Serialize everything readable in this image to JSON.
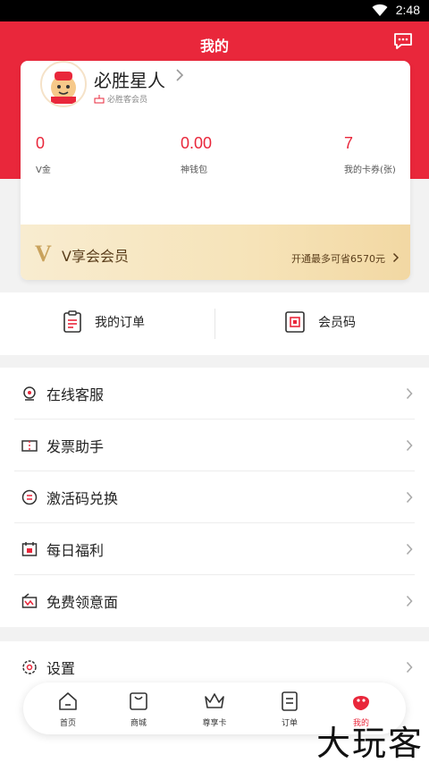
{
  "status_bar": {
    "time": "2:48"
  },
  "header": {
    "title": "我的"
  },
  "profile": {
    "username": "必胜星人",
    "member_tag": "必胜客会员",
    "stats": [
      {
        "value": "0",
        "label": "V金"
      },
      {
        "value": "0.00",
        "label": "神钱包"
      },
      {
        "value": "7",
        "label": "我的卡券(张)"
      }
    ]
  },
  "vip": {
    "logo": "V",
    "title": "V享会会员",
    "savings": "开通最多可省6570元"
  },
  "quick_actions": [
    {
      "label": "我的订单",
      "icon": "clipboard-icon"
    },
    {
      "label": "会员码",
      "icon": "qr-code-icon"
    }
  ],
  "menu": [
    {
      "label": "在线客服",
      "icon": "headset-icon"
    },
    {
      "label": "发票助手",
      "icon": "ticket-icon"
    },
    {
      "label": "激活码兑换",
      "icon": "exchange-icon"
    },
    {
      "label": "每日福利",
      "icon": "calendar-gift-icon"
    },
    {
      "label": "免费领意面",
      "icon": "pasta-icon"
    }
  ],
  "settings": {
    "label": "设置",
    "icon": "gear-icon"
  },
  "tabbar": [
    {
      "label": "首页",
      "icon": "home-icon"
    },
    {
      "label": "商城",
      "icon": "shop-bag-icon"
    },
    {
      "label": "尊享卡",
      "icon": "crown-icon"
    },
    {
      "label": "订单",
      "icon": "order-doc-icon"
    },
    {
      "label": "我的",
      "icon": "profile-blob-icon",
      "active": true
    }
  ],
  "watermark": "大玩客",
  "colors": {
    "brand_red": "#e9273b",
    "vip_gold": "#c9a25c"
  }
}
